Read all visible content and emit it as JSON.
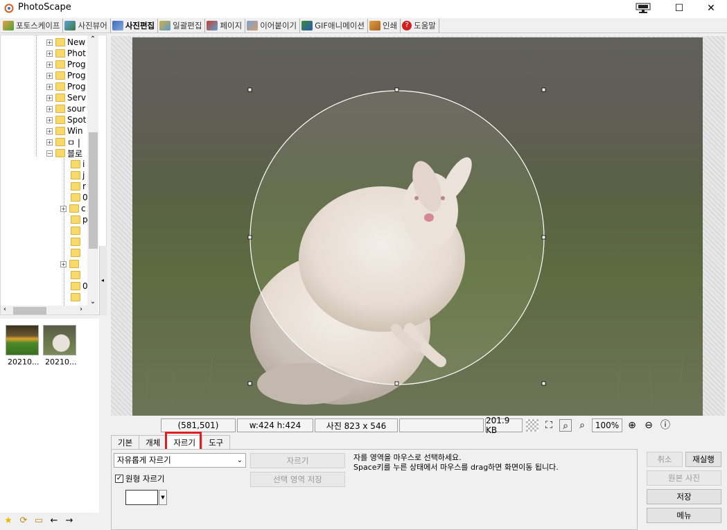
{
  "app": {
    "title": "PhotoScape"
  },
  "main_tabs": [
    {
      "label": "포토스케이프",
      "icon": "photoscape-home-icon",
      "active": false
    },
    {
      "label": "사진뷰어",
      "icon": "photo-viewer-icon",
      "active": false
    },
    {
      "label": "사진편집",
      "icon": "photo-editor-icon",
      "active": true
    },
    {
      "label": "일괄편집",
      "icon": "batch-editor-icon",
      "active": false
    },
    {
      "label": "페이지",
      "icon": "page-icon",
      "active": false
    },
    {
      "label": "이어붙이기",
      "icon": "combine-icon",
      "active": false
    },
    {
      "label": "GIF애니메이션",
      "icon": "gif-animation-icon",
      "active": false
    },
    {
      "label": "인쇄",
      "icon": "print-icon",
      "active": false
    },
    {
      "label": "도움말",
      "icon": "help-icon",
      "active": false
    }
  ],
  "tree": {
    "items": [
      "New",
      "Phot",
      "Prog",
      "Prog",
      "Prog",
      "Serv",
      "sour",
      "Spot",
      "Win",
      "ㅁ |",
      "블로"
    ],
    "sub_items": [
      "i",
      "j",
      "r",
      "0",
      "c",
      "p",
      "",
      "",
      "",
      "",
      "0",
      "",
      ""
    ]
  },
  "thumbnails": [
    {
      "label": "20210...",
      "icon": "landscape-thumbnail"
    },
    {
      "label": "20210...",
      "icon": "wallaby-thumbnail"
    }
  ],
  "status": {
    "coords": "(581,501)",
    "selection_size": "w:424 h:424",
    "photo_size": "사진 823 x 546",
    "blank": "",
    "file_size": "201.9 KB",
    "zoom": "100%"
  },
  "sub_tabs": [
    {
      "label": "기본",
      "active": false
    },
    {
      "label": "개체",
      "active": false
    },
    {
      "label": "자르기",
      "active": true
    },
    {
      "label": "도구",
      "active": false
    }
  ],
  "crop": {
    "mode_select": "자유롭게 자르기",
    "crop_button": "자르기",
    "save_selection_button": "선택 영역 저장",
    "circle_crop_checkbox": "원형 자르기",
    "circle_crop_checked": true,
    "help_line1": "자를 영역을 마우스로 선택하세요.",
    "help_line2": "Space키를 누른 상태에서 마우스를 drag하면 화면이동 됩니다."
  },
  "actions": {
    "undo": "취소",
    "redo": "재실행",
    "original": "원본 사진",
    "save": "저장",
    "menu": "메뉴"
  },
  "colors": {
    "highlight": "#e02020",
    "folder": "#f7d96b"
  }
}
